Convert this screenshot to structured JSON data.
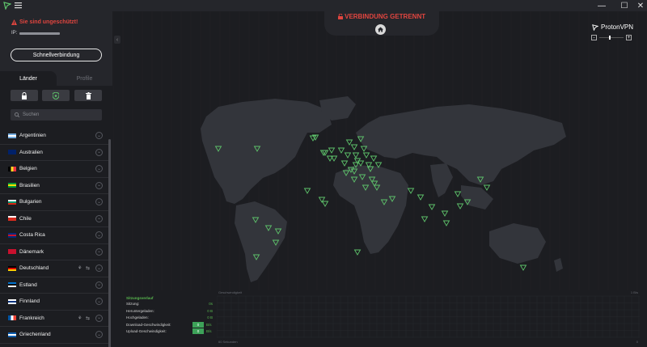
{
  "app": {
    "title": "ProtonVPN"
  },
  "titlebar": {
    "minimize_icon": "minimize-icon",
    "maximize_icon": "maximize-icon",
    "close_icon": "close-icon"
  },
  "sidebar": {
    "warning": "Sie sind ungeschützt!",
    "ip_label": "IP:",
    "quick_connect": "Schnellverbindung",
    "tabs": [
      "Länder",
      "Profile"
    ],
    "search_placeholder": "Suchen",
    "countries": [
      {
        "name": "Argentinien",
        "flag": [
          "#74acdf",
          "#ffffff",
          "#74acdf"
        ],
        "dir": "h"
      },
      {
        "name": "Australien",
        "flag": [
          "#012169",
          "#012169",
          "#012169"
        ],
        "dir": "h"
      },
      {
        "name": "Belgien",
        "flag": [
          "#000000",
          "#fdda24",
          "#ef3340"
        ],
        "dir": "v"
      },
      {
        "name": "Brasilien",
        "flag": [
          "#009c3b",
          "#ffdf00",
          "#009c3b"
        ],
        "dir": "h"
      },
      {
        "name": "Bulgarien",
        "flag": [
          "#ffffff",
          "#00966e",
          "#d62612"
        ],
        "dir": "h"
      },
      {
        "name": "Chile",
        "flag": [
          "#ffffff",
          "#d52b1e",
          "#d52b1e"
        ],
        "dir": "h"
      },
      {
        "name": "Costa Rica",
        "flag": [
          "#002b7f",
          "#ce1126",
          "#002b7f"
        ],
        "dir": "h"
      },
      {
        "name": "Dänemark",
        "flag": [
          "#c8102e",
          "#c8102e",
          "#c8102e"
        ],
        "dir": "h"
      },
      {
        "name": "Deutschland",
        "flag": [
          "#000000",
          "#dd0000",
          "#ffce00"
        ],
        "dir": "h",
        "features": true
      },
      {
        "name": "Estland",
        "flag": [
          "#0072ce",
          "#000000",
          "#ffffff"
        ],
        "dir": "h"
      },
      {
        "name": "Finnland",
        "flag": [
          "#ffffff",
          "#003580",
          "#ffffff"
        ],
        "dir": "h"
      },
      {
        "name": "Frankreich",
        "flag": [
          "#0055a4",
          "#ffffff",
          "#ef4135"
        ],
        "dir": "v",
        "features": true
      },
      {
        "name": "Griechenland",
        "flag": [
          "#0d5eaf",
          "#ffffff",
          "#0d5eaf"
        ],
        "dir": "h"
      }
    ]
  },
  "header": {
    "status": "VERBINDUNG GETRENNT",
    "brand": "ProtonVPN",
    "zoom_minus": "-",
    "zoom_plus": "+"
  },
  "session": {
    "title": "Sitzungsverlauf",
    "rows": [
      {
        "label": "Sitzung:",
        "value": "0s"
      },
      {
        "label": "Heruntergeladen:",
        "value": "0   B"
      },
      {
        "label": "Hochgeladen:",
        "value": "0   B"
      }
    ],
    "speed_rows": [
      {
        "label": "Download-Geschwindigkeit:",
        "value": "0",
        "unit": "B/s"
      },
      {
        "label": "Upload-Geschwindigkeit:",
        "value": "0",
        "unit": "B/s"
      }
    ]
  },
  "graph": {
    "title": "Geschwindigkeit",
    "ymax": "1 B/s",
    "xmin": "60 Sekunden",
    "xmax": "0"
  },
  "colors": {
    "accent_green": "#59b94f",
    "danger": "#e0453f",
    "bg": "#1c1d21",
    "panel": "#25262b"
  }
}
